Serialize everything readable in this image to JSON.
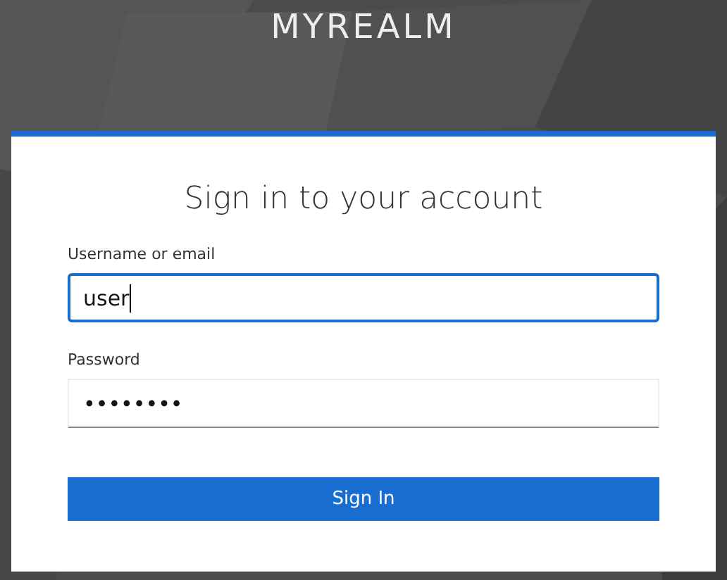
{
  "realm_title": "MYREALM",
  "card": {
    "heading": "Sign in to your account",
    "fields": [
      {
        "label": "Username or email",
        "value": "user",
        "focused": true
      },
      {
        "label": "Password",
        "value": "••••••••",
        "focused": false
      }
    ],
    "submit": "Sign In"
  }
}
